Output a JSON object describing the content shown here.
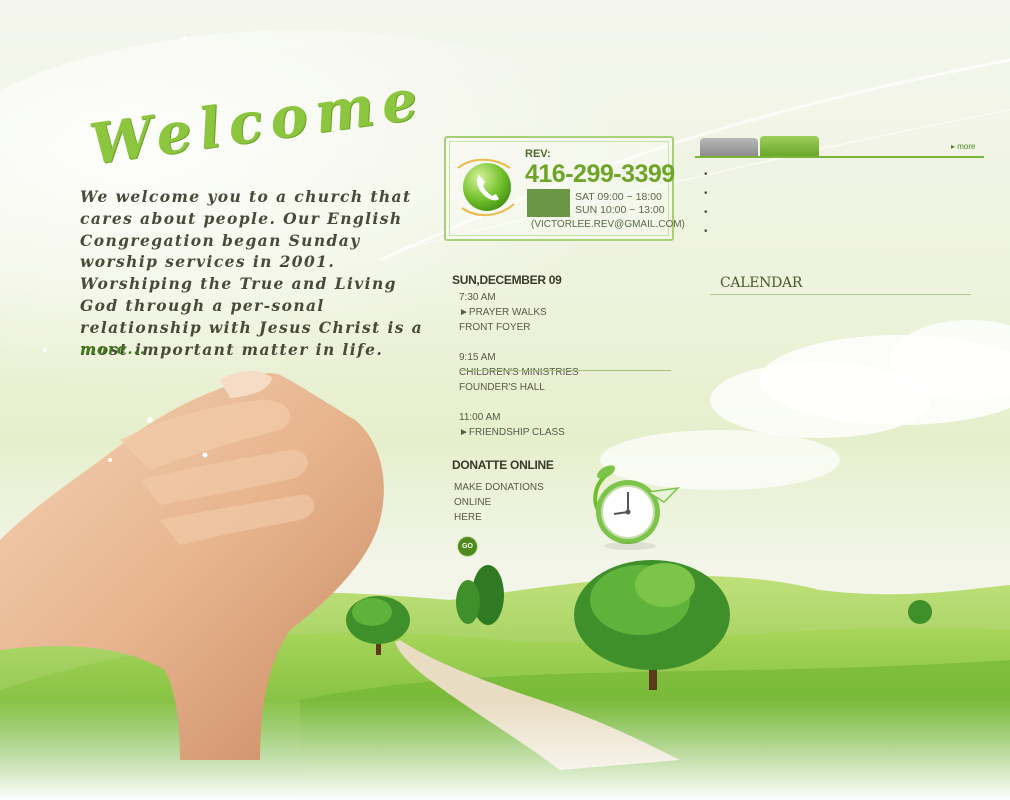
{
  "welcome": {
    "title": "Welcome",
    "body": "We welcome you to a church that cares about people.  Our English Congregation began Sunday worship services in 2001.  Worshiping the True and Living God through a per-sonal relationship with Jesus Christ is a most important matter in life.",
    "more": "more..."
  },
  "contact": {
    "rev_label": "REV:",
    "phone": "416-299-3399",
    "hours_sat": "SAT 09:00 ~ 18:00",
    "hours_sun": "SUN 10:00 ~ 13:00",
    "email": "(VICTORLEE.REV@GMAIL.COM)",
    "icon": "phone-icon"
  },
  "schedule": {
    "date": "SUN,DECEMBER 09",
    "events": [
      {
        "time": "7:30 AM",
        "title": "►PRAYER WALKS",
        "place": "FRONT FOYER"
      },
      {
        "time": "9:15 AM",
        "title": "CHILDREN'S MINISTRIES",
        "place": "FOUNDER'S HALL"
      },
      {
        "time": "11:00 AM",
        "title": "►FRIENDSHIP CLASS",
        "place": ""
      }
    ]
  },
  "donate": {
    "title": "DONATTE ONLINE",
    "line1": "MAKE DONATIONS",
    "line2": "ONLINE",
    "line3": "HERE",
    "go": "GO"
  },
  "notice": {
    "more": "▸ more",
    "items": [
      "",
      "",
      "",
      ""
    ]
  },
  "calendar": {
    "title": "CALENDAR"
  },
  "colors": {
    "accent": "#8cc63f",
    "dark_green": "#4f8a1f",
    "text": "#4a4a3a"
  }
}
